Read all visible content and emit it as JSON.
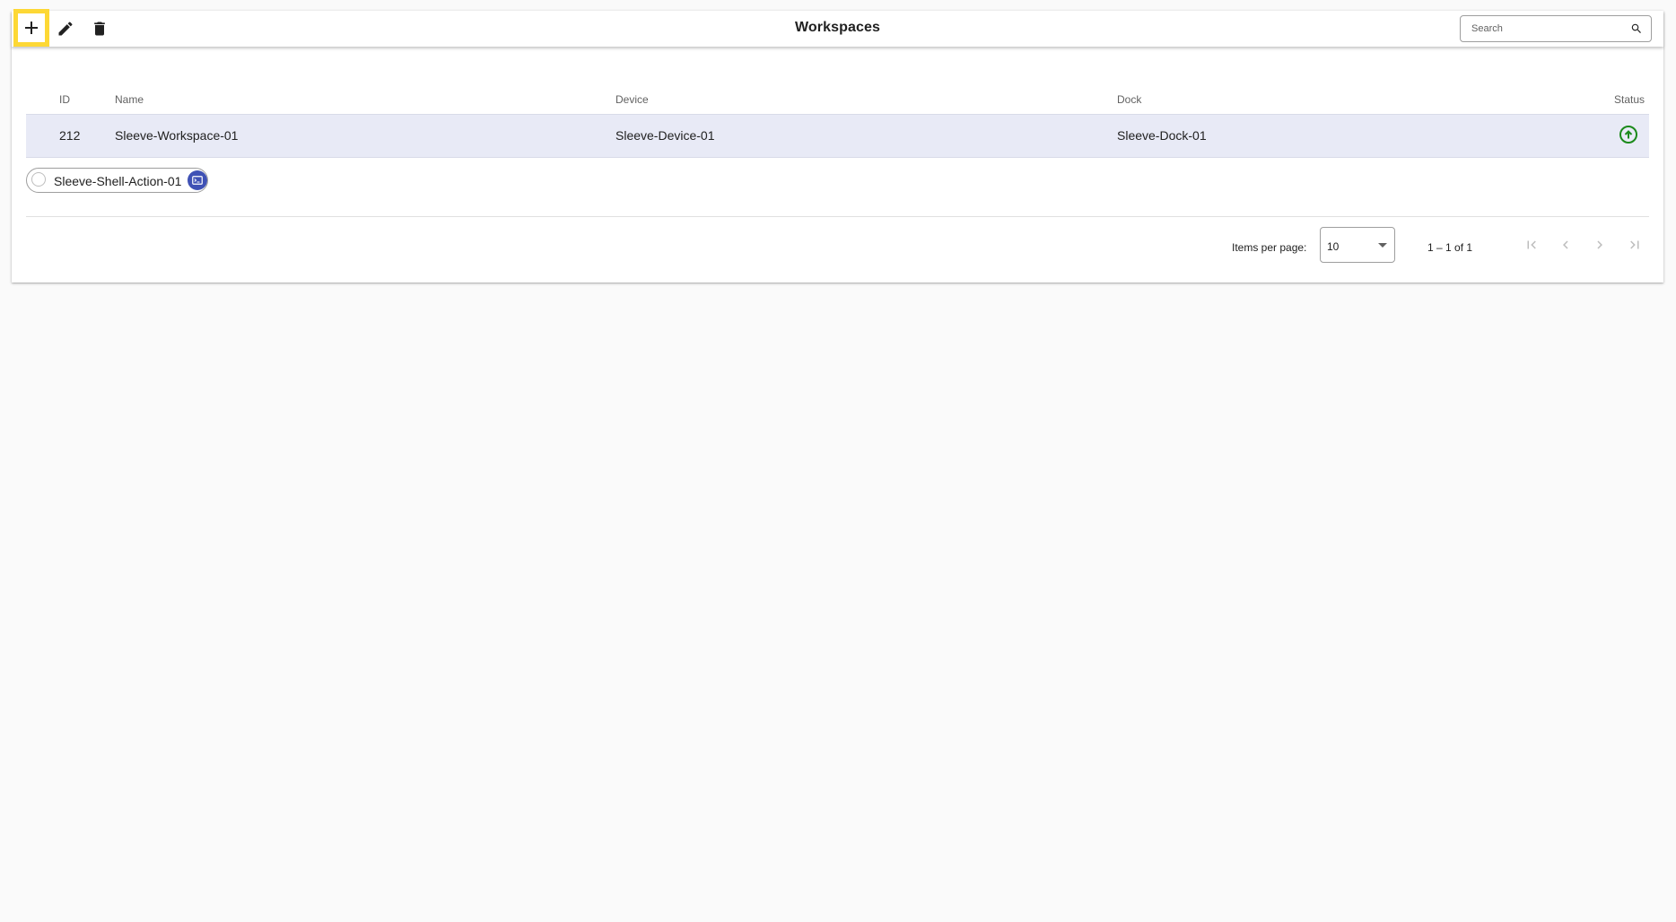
{
  "toolbar": {
    "title": "Workspaces",
    "add_icon": "plus-icon",
    "edit_icon": "pencil-icon",
    "delete_icon": "trash-icon",
    "search_placeholder": "Search",
    "search_value": ""
  },
  "table": {
    "columns": [
      "ID",
      "Name",
      "Device",
      "Dock",
      "Status"
    ],
    "rows": [
      {
        "id": "212",
        "name": "Sleeve-Workspace-01",
        "device": "Sleeve-Device-01",
        "dock": "Sleeve-Dock-01",
        "status_icon": "arrow-up-circle-icon",
        "status_color": "#1b8a1b"
      }
    ]
  },
  "actions": [
    {
      "label": "Sleeve-Shell-Action-01",
      "icon": "terminal-icon",
      "badge_color": "#3f51b5"
    }
  ],
  "paginator": {
    "items_per_page_label": "Items per page:",
    "items_per_page": "10",
    "range_label": "1 – 1 of 1"
  },
  "colors": {
    "highlight": "#fdd835",
    "selected_row": "#e8eaf6"
  }
}
